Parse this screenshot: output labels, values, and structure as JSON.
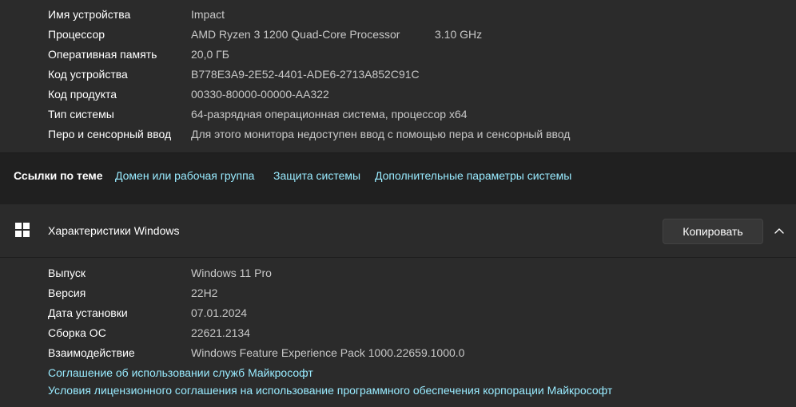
{
  "device_specs": {
    "rows": [
      {
        "label": "Имя устройства",
        "value": "Impact"
      },
      {
        "label": "Процессор",
        "value": "AMD Ryzen 3 1200 Quad-Core Processor",
        "extra": "3.10 GHz"
      },
      {
        "label": "Оперативная память",
        "value": "20,0 ГБ"
      },
      {
        "label": "Код устройства",
        "value": "B778E3A9-2E52-4401-ADE6-2713A852C91C"
      },
      {
        "label": "Код продукта",
        "value": "00330-80000-00000-AA322"
      },
      {
        "label": "Тип системы",
        "value": "64-разрядная операционная система, процессор x64"
      },
      {
        "label": "Перо и сенсорный ввод",
        "value": "Для этого монитора недоступен ввод с помощью пера и сенсорный ввод"
      }
    ]
  },
  "related_links": {
    "title": "Ссылки по теме",
    "items": [
      "Домен или рабочая группа",
      "Защита системы",
      "Дополнительные параметры системы"
    ]
  },
  "windows_specs": {
    "title": "Характеристики Windows",
    "copy_label": "Копировать",
    "rows": [
      {
        "label": "Выпуск",
        "value": "Windows 11 Pro"
      },
      {
        "label": "Версия",
        "value": "22H2"
      },
      {
        "label": "Дата установки",
        "value": "07.01.2024"
      },
      {
        "label": "Сборка ОС",
        "value": "22621.2134"
      },
      {
        "label": "Взаимодействие",
        "value": "Windows Feature Experience Pack 1000.22659.1000.0"
      }
    ],
    "links": [
      "Соглашение об использовании служб Майкрософт",
      "Условия лицензионного соглашения на использование программного обеспечения корпорации Майкрософт"
    ]
  },
  "icons": {
    "windows": "windows-logo-icon",
    "collapse": "chevron-up-icon"
  },
  "colors": {
    "background": "#202020",
    "card": "#2b2b2b",
    "link": "#99ebff",
    "secondary_text": "#c8c8c8"
  }
}
